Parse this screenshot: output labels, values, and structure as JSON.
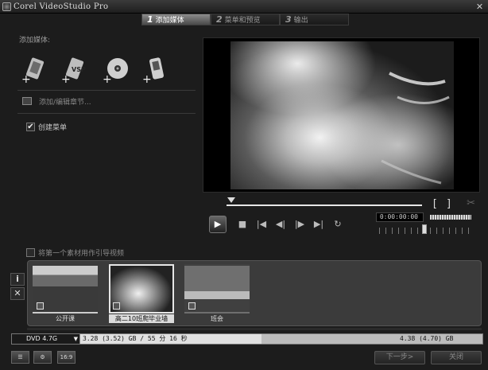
{
  "window": {
    "title": "Corel VideoStudio Pro",
    "close_glyph": "✕"
  },
  "steps": [
    {
      "num": "1",
      "label": "添加媒体",
      "active": true
    },
    {
      "num": "2",
      "label": "菜单和预览",
      "active": false
    },
    {
      "num": "3",
      "label": "输出",
      "active": false
    }
  ],
  "left": {
    "add_media_label": "添加媒体:",
    "media_buttons": [
      "add-video-icon",
      "add-vsp-icon",
      "add-disc-icon",
      "add-device-icon"
    ],
    "vsp_badge": "VSP",
    "chapter_label": "添加/编辑章节...",
    "create_menu_label": "创建菜单",
    "create_menu_checked": true
  },
  "player": {
    "mark_in": "[",
    "mark_out": "]",
    "timecode": "0:00:00:00",
    "scissor_glyph": "✂"
  },
  "intro_label": "将第一个素材用作引导视频",
  "side_tools": {
    "info_glyph": "i",
    "delete_glyph": "✕"
  },
  "clips": [
    {
      "label": "公开课",
      "selected": false
    },
    {
      "label": "高二10班爬毕业墙",
      "selected": true
    },
    {
      "label": "班会",
      "selected": false
    }
  ],
  "disc": {
    "type": "DVD 4.7G",
    "used": "3.28 (3.52) GB / 55 分 16 秒",
    "free": "4.38 (4.70) GB"
  },
  "footer": {
    "tool_labels": [
      "",
      "",
      "16:9"
    ],
    "next": "下一步>",
    "close": "关闭"
  }
}
